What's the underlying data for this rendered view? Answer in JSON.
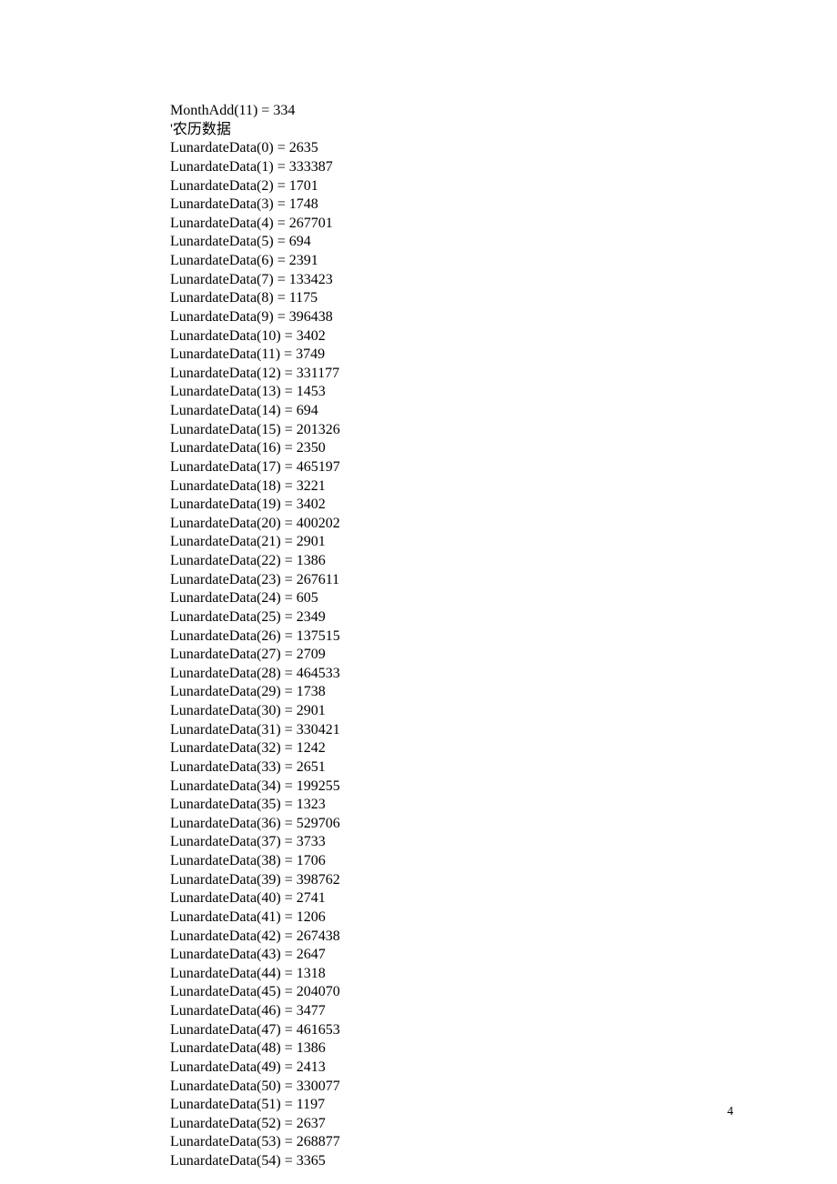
{
  "lines": [
    "MonthAdd(11) = 334",
    "'农历数据",
    "LunardateData(0) = 2635",
    "LunardateData(1) = 333387",
    "LunardateData(2) = 1701",
    "LunardateData(3) = 1748",
    "LunardateData(4) = 267701",
    "LunardateData(5) = 694",
    "LunardateData(6) = 2391",
    "LunardateData(7) = 133423",
    "LunardateData(8) = 1175",
    "LunardateData(9) = 396438",
    "LunardateData(10) = 3402",
    "LunardateData(11) = 3749",
    "LunardateData(12) = 331177",
    "LunardateData(13) = 1453",
    "LunardateData(14) = 694",
    "LunardateData(15) = 201326",
    "LunardateData(16) = 2350",
    "LunardateData(17) = 465197",
    "LunardateData(18) = 3221",
    "LunardateData(19) = 3402",
    "LunardateData(20) = 400202",
    "LunardateData(21) = 2901",
    "LunardateData(22) = 1386",
    "LunardateData(23) = 267611",
    "LunardateData(24) = 605",
    "LunardateData(25) = 2349",
    "LunardateData(26) = 137515",
    "LunardateData(27) = 2709",
    "LunardateData(28) = 464533",
    "LunardateData(29) = 1738",
    "LunardateData(30) = 2901",
    "LunardateData(31) = 330421",
    "LunardateData(32) = 1242",
    "LunardateData(33) = 2651",
    "LunardateData(34) = 199255",
    "LunardateData(35) = 1323",
    "LunardateData(36) = 529706",
    "LunardateData(37) = 3733",
    "LunardateData(38) = 1706",
    "LunardateData(39) = 398762",
    "LunardateData(40) = 2741",
    "LunardateData(41) = 1206",
    "LunardateData(42) = 267438",
    "LunardateData(43) = 2647",
    "LunardateData(44) = 1318",
    "LunardateData(45) = 204070",
    "LunardateData(46) = 3477",
    "LunardateData(47) = 461653",
    "LunardateData(48) = 1386",
    "LunardateData(49) = 2413",
    "LunardateData(50) = 330077",
    "LunardateData(51) = 1197",
    "LunardateData(52) = 2637",
    "LunardateData(53) = 268877",
    "LunardateData(54) = 3365"
  ],
  "page_number": "4"
}
